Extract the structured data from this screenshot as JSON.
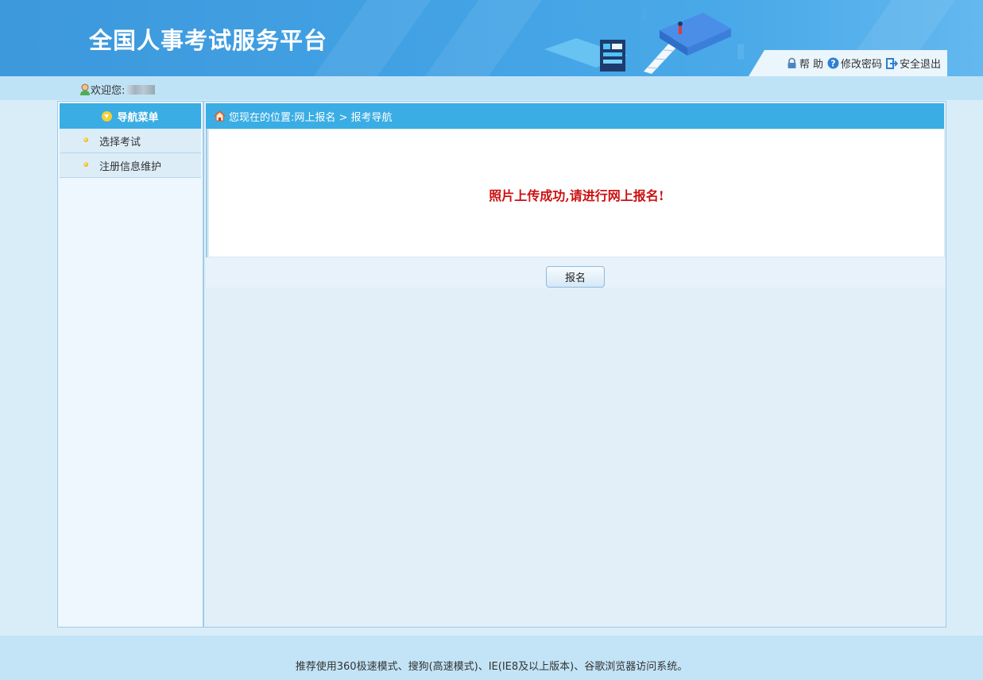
{
  "header": {
    "title": "全国人事考试服务平台",
    "links": [
      {
        "label": "帮 助",
        "icon": "lock-icon"
      },
      {
        "label": "修改密码",
        "icon": "question-icon"
      },
      {
        "label": "安全退出",
        "icon": "exit-icon"
      }
    ]
  },
  "welcome": {
    "label": "欢迎您:"
  },
  "sidebar": {
    "title": "导航菜单",
    "items": [
      {
        "label": "选择考试"
      },
      {
        "label": "注册信息维护"
      }
    ]
  },
  "breadcrumb": {
    "text": "您现在的位置:网上报名 > 报考导航"
  },
  "main": {
    "message": "照片上传成功,请进行网上报名!",
    "button": "报名"
  },
  "footer": {
    "text": "推荐使用360极速模式、搜狗(高速模式)、IE(IE8及以上版本)、谷歌浏览器访问系统。"
  },
  "colors": {
    "header": "#42a2e4",
    "nav_bar": "#39ade4",
    "message": "#cc1111"
  }
}
